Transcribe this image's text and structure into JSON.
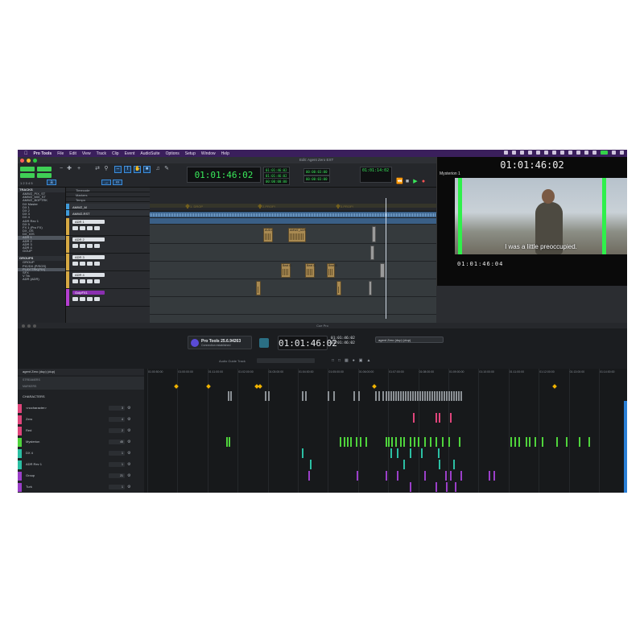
{
  "menubar": {
    "app": "Pro Tools",
    "items": [
      "File",
      "Edit",
      "View",
      "Track",
      "Clip",
      "Event",
      "AudioSuite",
      "Options",
      "Setup",
      "Window",
      "Help"
    ]
  },
  "edit_window": {
    "title": "Edit: Agent Zero EXT",
    "main_counter": "01:01:46:02",
    "sub_counters": [
      "01:01:46:02",
      "01:01:46:02",
      "00:00:00:00"
    ],
    "pre_roll": "00:00:03:00",
    "post_roll": "00:00:03:00",
    "transport_counter": "01:01:14:02",
    "tracks_header": "TRACKS",
    "groups_header": "GROUPS",
    "track_list": [
      "AMWZ_PIX_ST",
      "AMWZ_MIX_ST",
      "AMWZ_BOPTRK",
      "DX Master",
      "DX 1",
      "DX 2",
      "DX 3",
      "DX 4",
      "ADR Rev 1",
      "DX 5",
      "FX 1 (Pro FX)",
      "DX_OS",
      "DX_IOS",
      "ADR 1",
      "ADR 2",
      "ADR 3",
      "ADR 4",
      "GOUP"
    ],
    "groups_list": [
      "GROUP",
      "PIC/DX (P/SOS)",
      "PLAY/TRK(PIX)",
      "SFX",
      "V Trk",
      "ADR (ADR)"
    ],
    "track_headers": [
      "Timecode",
      "Markers",
      "Tempo",
      "AMWZ_M",
      "AMWZ-RST",
      "ADR 1",
      "ADR 2",
      "ADR 3",
      "ADR 4",
      "GoipFX1"
    ],
    "markers": [
      "1. DROP",
      "2.PROP!",
      "3.PROP!"
    ],
    "clips": [
      "AUD1",
      "AMWZ_ADR",
      "Beat G",
      "Beat G",
      "Beat G"
    ]
  },
  "video_window": {
    "timecode": "01:01:46:02",
    "character": "Mysterion 1",
    "subtitle": "I was a little preoccupied.",
    "timecode2": "01:01:46:04"
  },
  "cue_pro": {
    "title": "Cue Pro",
    "status_title": "Pro Tools 25.6.94263",
    "status_sub": "Connection established",
    "clock": "01:01:46:02",
    "in_tc": "01:01:46:02",
    "out_tc": "01:01:46:02",
    "selection": "agent Zero (dup) (dup)",
    "guide_label": "Audio Guide Track",
    "list_header": "agent Zero (dup) (dup)",
    "sections": [
      "STREAMERS",
      "MARKERS",
      "CHARACTERS"
    ],
    "characters": [
      {
        "name": "<nocharacter>",
        "count": "3",
        "color": "#e0457b"
      },
      {
        "name": "Zero",
        "count": "4",
        "color": "#e0457b"
      },
      {
        "name": "Red",
        "count": "2",
        "color": "#e0457b"
      },
      {
        "name": "Mysterion",
        "count": "45",
        "color": "#4fd43c"
      },
      {
        "name": "DX 4",
        "count": "1",
        "color": "#2bbfa3"
      },
      {
        "name": "ADR Rev 1",
        "count": "1",
        "color": "#2bbfa3"
      },
      {
        "name": "Group",
        "count": "21",
        "color": "#9b3fc9"
      },
      {
        "name": "Turk",
        "count": "1",
        "color": "#9b3fc9"
      }
    ],
    "timeline_ticks": [
      "01:00:50:00",
      "01:00:00:00",
      "01:11:00:00",
      "01:02:00:00",
      "01:03:00:00",
      "01:04:00:00",
      "01:05:00:00",
      "01:06:00:00",
      "01:07:00:00",
      "01:08:00:00",
      "01:09:00:00",
      "01:10:00:00",
      "01:11:00:00",
      "01:12:00:00",
      "01:13:00:00",
      "01:14:00:00"
    ]
  }
}
